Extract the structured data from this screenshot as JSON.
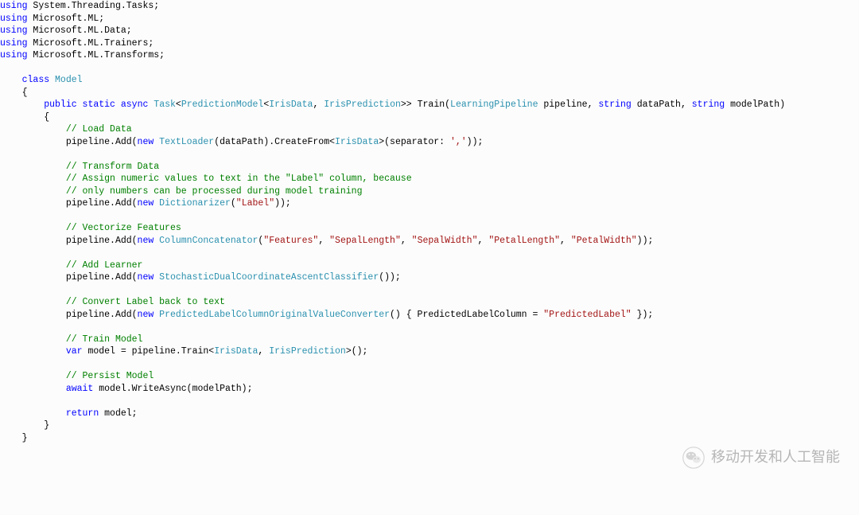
{
  "code": {
    "usings": [
      "System.Threading.Tasks",
      "Microsoft.ML",
      "Microsoft.ML.Data",
      "Microsoft.ML.Trainers",
      "Microsoft.ML.Transforms"
    ],
    "class_kw": "class",
    "class_name": "Model",
    "method_sig": {
      "public": "public",
      "static": "static",
      "async": "async",
      "task": "Task",
      "pm": "PredictionModel",
      "irisdata": "IrisData",
      "irispred": "IrisPrediction",
      "train": "Train",
      "lp": "LearningPipeline",
      "pipeline": "pipeline",
      "string": "string",
      "dataPath": "dataPath",
      "modelPath": "modelPath"
    },
    "c_load": "// Load Data",
    "l_load_a": "pipeline.Add(",
    "new": "new",
    "TextLoader": "TextLoader",
    "l_load_b": "(dataPath).CreateFrom<",
    "l_load_c": ">(separator: ",
    "l_load_sep": "','",
    "l_load_d": "));",
    "c_trans1": "// Transform Data",
    "c_trans2": "// Assign numeric values to text in the \"Label\" column, because",
    "c_trans3": "// only numbers can be processed during model training",
    "Dictionarizer": "Dictionarizer",
    "label_str": "\"Label\"",
    "close2": "));",
    "c_vec": "// Vectorize Features",
    "ColumnConcatenator": "ColumnConcatenator",
    "features_str": "\"Features\"",
    "sl": "\"SepalLength\"",
    "sw": "\"SepalWidth\"",
    "pl": "\"PetalLength\"",
    "pw": "\"PetalWidth\"",
    "c_learner": "// Add Learner",
    "SDCA": "StochasticDualCoordinateAscentClassifier",
    "sdca_tail": "());",
    "c_conv": "// Convert Label back to text",
    "PLCOVC": "PredictedLabelColumnOriginalValueConverter",
    "plc_mid": "() { PredictedLabelColumn = ",
    "plc_str": "\"PredictedLabel\"",
    "plc_tail": " });",
    "c_train": "// Train Model",
    "var": "var",
    "train_line": " model = pipeline.Train<",
    "train_tail": ">();",
    "c_persist": "// Persist Model",
    "await": "await",
    "persist_line": " model.WriteAsync(modelPath);",
    "return": "return",
    "ret_tail": " model;"
  },
  "watermark_text": "移动开发和人工智能"
}
